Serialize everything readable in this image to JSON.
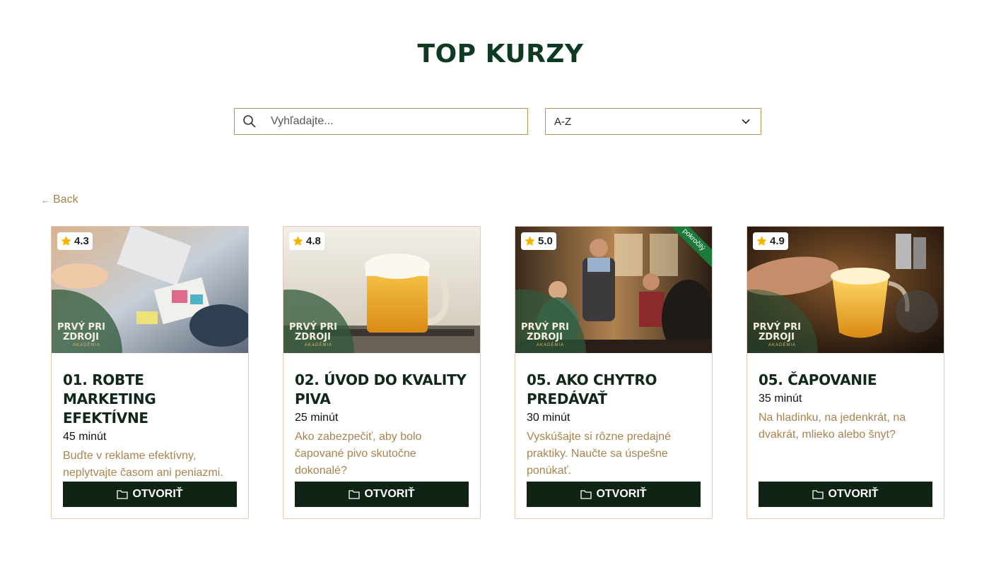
{
  "page": {
    "title": "TOP KURZY"
  },
  "search": {
    "placeholder": "Vyhľadajte..."
  },
  "sort": {
    "selected": "A-Z"
  },
  "nav": {
    "back_label": "Back"
  },
  "colors": {
    "brand_dark": "#0f2414",
    "accent_gold": "#b8924f",
    "title_green": "#0f3a22",
    "ribbon_green": "#1b7a3a"
  },
  "logo": {
    "line1": "PRVÝ PRI",
    "line2": "ZDROJI",
    "line3": "AKADÉMIA"
  },
  "cards": [
    {
      "rating": "4.3",
      "title": "01. ROBTE MARKETING EFEKTÍVNE",
      "duration": "45 minút",
      "description": "Buďte v reklame efektívny, neplytvajte časom ani peniazmi.",
      "button": "OTVORIŤ",
      "level": ""
    },
    {
      "rating": "4.8",
      "title": "02. ÚVOD DO KVALITY PIVA",
      "duration": "25 minút",
      "description": "Ako zabezpečiť, aby bolo čapované pivo skutočne dokonalé?",
      "button": "OTVORIŤ",
      "level": ""
    },
    {
      "rating": "5.0",
      "title": "05. AKO CHYTRO PREDÁVAŤ",
      "duration": "30 minút",
      "description": "Vyskúšajte si rôzne predajné praktiky. Naučte sa úspešne ponúkať.",
      "button": "OTVORIŤ",
      "level": "pokročilý"
    },
    {
      "rating": "4.9",
      "title": "05. ČAPOVANIE",
      "duration": "35 minút",
      "description": "Na hladinku, na jedenkrát, na dvakrát, mlieko alebo šnyt?",
      "button": "OTVORIŤ",
      "level": ""
    }
  ]
}
